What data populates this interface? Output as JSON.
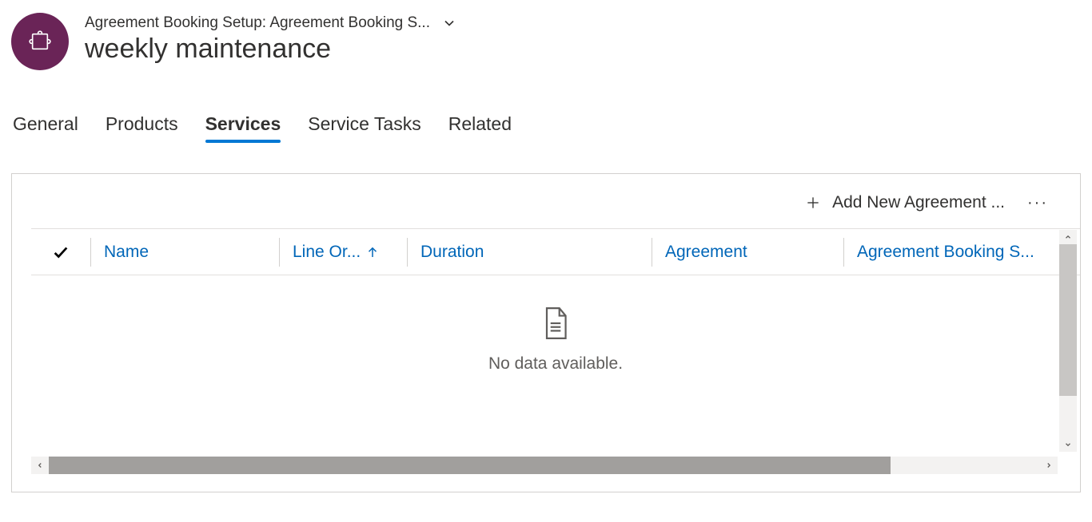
{
  "header": {
    "breadcrumb": "Agreement Booking Setup: Agreement Booking S...",
    "title": "weekly maintenance"
  },
  "tabs": [
    {
      "id": "general",
      "label": "General",
      "active": false
    },
    {
      "id": "products",
      "label": "Products",
      "active": false
    },
    {
      "id": "services",
      "label": "Services",
      "active": true
    },
    {
      "id": "service-tasks",
      "label": "Service Tasks",
      "active": false
    },
    {
      "id": "related",
      "label": "Related",
      "active": false
    }
  ],
  "grid": {
    "add_button_label": "Add New Agreement ...",
    "columns": {
      "name": "Name",
      "line": "Line Or...",
      "duration": "Duration",
      "agreement": "Agreement",
      "abs": "Agreement Booking S..."
    },
    "sorted_column": "line",
    "sort_direction": "asc",
    "empty_message": "No data available.",
    "rows": []
  }
}
